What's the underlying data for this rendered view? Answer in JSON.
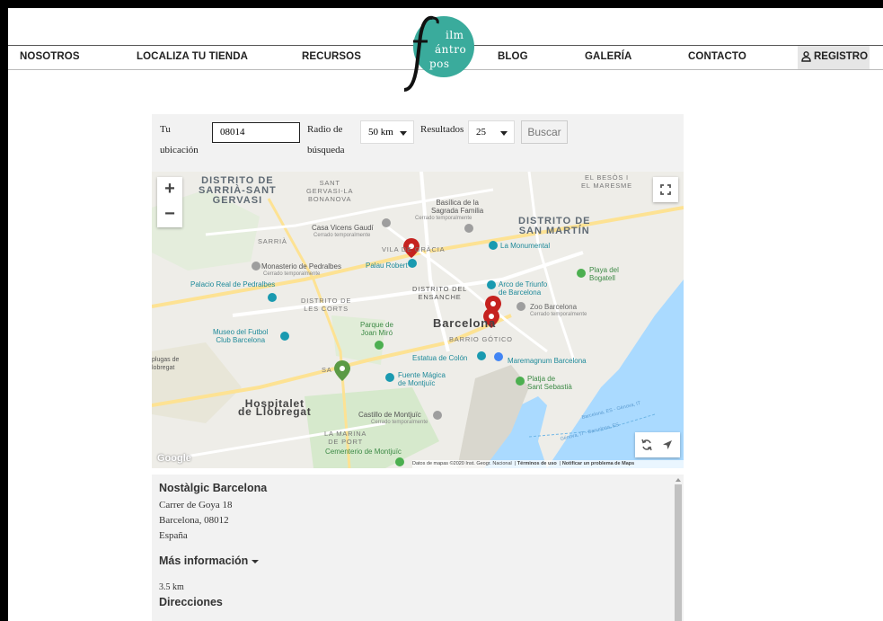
{
  "nav": {
    "items": [
      "NOSOTROS",
      "LOCALIZA TU TIENDA",
      "RECURSOS",
      "BLOG",
      "GALERÍA",
      "CONTACTO"
    ],
    "registro": "REGISTRO"
  },
  "logo": {
    "line1": "ilm",
    "line2": "ántro",
    "line3": "pos"
  },
  "form": {
    "location_label_1": "Tu",
    "location_label_2": "ubicación",
    "location_value": "08014",
    "radius_label_1": "Radio de",
    "radius_label_2": "búsqueda",
    "radius_value": "50 km",
    "results_label": "Resultados",
    "results_value": "25",
    "search_button": "Buscar"
  },
  "map": {
    "labels": {
      "sarria": [
        "DISTRITO DE",
        "SARRIÀ-SANT",
        "GERVASI"
      ],
      "sant_gervasi": [
        "SANT",
        "GERVASI-LA",
        "BONANOVA"
      ],
      "besos": [
        "EL BESÒS I",
        "EL MARESME"
      ],
      "sagrada": [
        "Basílica de la",
        "Sagrada Familia"
      ],
      "sagrada_sub": "Cerrado temporalmente",
      "sant_marti": [
        "DISTRITO DE",
        "SAN MARTÍN"
      ],
      "vicens": "Casa Vicens Gaudí",
      "vicens_sub": "Cerrado temporalmente",
      "sarria2": "SARRIÀ",
      "gracia": "VILA DE GRÀCIA",
      "monumental": "La Monumental",
      "pedralbes": "Monasterio de Pedralbes",
      "pedralbes_sub": "Cerrado temporalmente",
      "palau_robert": "Palau Robert",
      "bogatell": [
        "Playa del",
        "Bogatell"
      ],
      "palacio": "Palacio Real de Pedralbes",
      "les_corts": [
        "DISTRITO DE",
        "LES CORTS"
      ],
      "ensanche": [
        "DISTRITO DEL",
        "ENSANCHE"
      ],
      "arco": [
        "Arco de Triunfo",
        "de Barcelona"
      ],
      "zoo": "Zoo Barcelona",
      "zoo_sub": "Cerrado temporalmente",
      "museo": [
        "Museo del Futbol",
        "Club Barcelona"
      ],
      "miro": [
        "Parque de",
        "Joan Miró"
      ],
      "barcelona": "Barcelona",
      "gotico": "BARRIO GÓTICO",
      "colon": "Estatua de Colón",
      "maremagnum": "Maremagnum Barcelona",
      "platjas": [
        "plugas de",
        "lobregat"
      ],
      "sants": "SA",
      "fuente": [
        "Fuente Mágica",
        "de Montjuïc"
      ],
      "sebastia": [
        "Platja de",
        "Sant Sebastià"
      ],
      "hospitalet": [
        "Hospitalet",
        "de Llobregat"
      ],
      "castillo": "Castillo de Montjuïc",
      "castillo_sub": "Cerrado temporalmente",
      "marina": [
        "LA MARINA",
        "DE PORT"
      ],
      "cementerio": "Cementerio de Montjuïc",
      "ferry1": "Barcelona, ES - Génova, IT",
      "ferry2": "Génova, IT - Barcelona, ES"
    },
    "zoom_in": "+",
    "zoom_out": "−",
    "google": "Google",
    "attribution": "Datos de mapas ©2020 Inst. Geogr. Nacional",
    "terms": "Términos de uso",
    "report": "Notificar un problema de Maps"
  },
  "result": {
    "name": "Nostàlgic Barcelona",
    "street": "Carrer de Goya 18",
    "city": "Barcelona, 08012",
    "country": "España",
    "more": "Más información",
    "distance": "3.5 km",
    "directions": "Direcciones"
  },
  "colors": {
    "logo_teal": "#3aab9c",
    "marker_red": "#c5221f",
    "marker_green": "#5b9a45",
    "water": "#aadaff"
  }
}
